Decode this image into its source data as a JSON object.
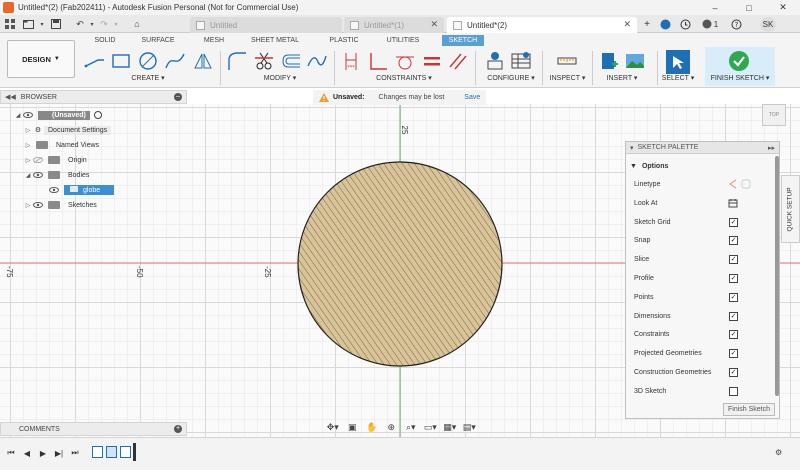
{
  "window": {
    "title": "Untitled*(2) (Fab202411) - Autodesk Fusion Personal (Not for Commercial Use)",
    "minimize": "–",
    "maximize": "□",
    "close": "✕"
  },
  "tabs": [
    {
      "label": "Untitled",
      "active": false
    },
    {
      "label": "Untitled*(1)",
      "active": false
    },
    {
      "label": "Untitled*(2)",
      "active": true
    }
  ],
  "tabbar_right": {
    "notifications": "1",
    "user_initials": "SK"
  },
  "toolbar": {
    "workspace": "DESIGN",
    "workspace_tabs": [
      "SOLID",
      "SURFACE",
      "MESH",
      "SHEET METAL",
      "PLASTIC",
      "UTILITIES",
      "SKETCH"
    ],
    "groups": [
      "CREATE",
      "MODIFY",
      "CONSTRAINTS",
      "CONFIGURE",
      "INSPECT",
      "INSERT",
      "SELECT",
      "FINISH SKETCH"
    ]
  },
  "browser": {
    "title": "BROWSER",
    "items": [
      {
        "label": "(Unsaved)"
      },
      {
        "label": "Document Settings"
      },
      {
        "label": "Named Views"
      },
      {
        "label": "Origin"
      },
      {
        "label": "Bodies"
      },
      {
        "label": "globe"
      },
      {
        "label": "Sketches"
      }
    ]
  },
  "unsaved_bar": {
    "label": "Unsaved:",
    "message": "Changes may be lost",
    "save_link": "Save"
  },
  "axes": {
    "vertical_label": "25",
    "horizontal_labels": [
      "-75",
      "-50",
      "-25"
    ]
  },
  "viewcube": {
    "face": "TOP"
  },
  "sketch_palette": {
    "title": "SKETCH PALETTE",
    "section": "Options",
    "linetype_label": "Linetype",
    "look_at_label": "Look At",
    "options": [
      {
        "label": "Sketch Grid",
        "checked": true
      },
      {
        "label": "Snap",
        "checked": true
      },
      {
        "label": "Slice",
        "checked": true
      },
      {
        "label": "Profile",
        "checked": true
      },
      {
        "label": "Points",
        "checked": true
      },
      {
        "label": "Dimensions",
        "checked": true
      },
      {
        "label": "Constraints",
        "checked": true
      },
      {
        "label": "Projected Geometries",
        "checked": true
      },
      {
        "label": "Construction Geometries",
        "checked": true
      },
      {
        "label": "3D Sketch",
        "checked": false
      }
    ],
    "finish_button": "Finish Sketch"
  },
  "quick_setup": "QUICK SETUP",
  "comments": {
    "title": "COMMENTS"
  },
  "colors": {
    "accent": "#5a9fd4",
    "profile_fill": "#d9c49a",
    "x_axis": "#e07070",
    "y_axis": "#5dbb63",
    "selection": "#3b8fd6",
    "finish_check": "#2fa84f"
  }
}
